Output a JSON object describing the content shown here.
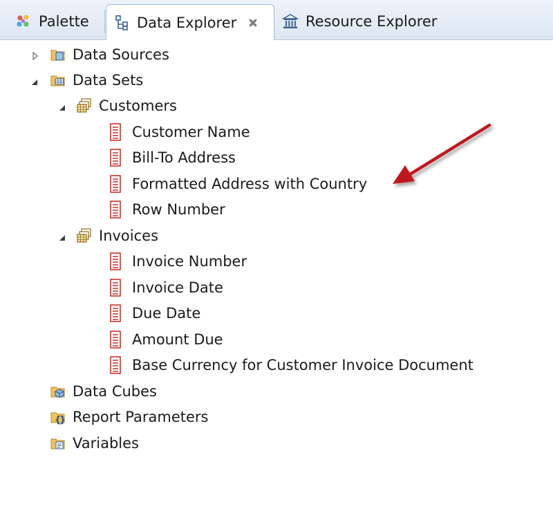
{
  "tabs": [
    {
      "label": "Palette",
      "icon": "palette-icon",
      "active": false
    },
    {
      "label": "Data Explorer",
      "icon": "data-explorer-icon",
      "active": true,
      "close_icon": "close-icon"
    },
    {
      "label": "Resource Explorer",
      "icon": "resource-explorer-icon",
      "active": false
    }
  ],
  "tree": {
    "data_sources": {
      "label": "Data Sources",
      "expanded": false,
      "icon": "data-source-folder-icon"
    },
    "data_sets": {
      "label": "Data Sets",
      "expanded": true,
      "icon": "data-set-folder-icon",
      "children": [
        {
          "label": "Customers",
          "expanded": true,
          "icon": "data-set-icon",
          "columns": [
            "Customer Name",
            "Bill-To Address",
            "Formatted Address with Country",
            "Row Number"
          ]
        },
        {
          "label": "Invoices",
          "expanded": true,
          "icon": "data-set-icon",
          "columns": [
            "Invoice Number",
            "Invoice Date",
            "Due Date",
            "Amount Due",
            "Base Currency for Customer Invoice Document"
          ]
        }
      ]
    },
    "data_cubes": {
      "label": "Data Cubes",
      "icon": "data-cube-folder-icon"
    },
    "report_parameters": {
      "label": "Report Parameters",
      "icon": "report-parameters-folder-icon"
    },
    "variables": {
      "label": "Variables",
      "icon": "variables-folder-icon"
    }
  },
  "colors": {
    "annotation_arrow": "#c0141c",
    "column_icon": "#c8322a",
    "folder": "#e8b24a",
    "tab_bar": "#dde6f2"
  }
}
